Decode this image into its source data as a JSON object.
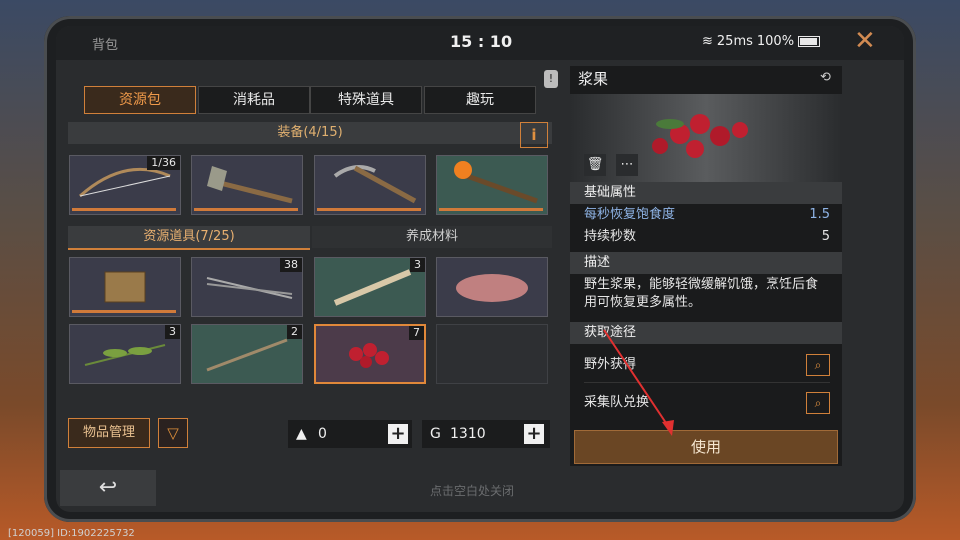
{
  "status_bar": {
    "title": "背包",
    "time": "15 : 10",
    "network": "25ms",
    "battery": "100%"
  },
  "tabs": [
    "资源包",
    "消耗品",
    "特殊道具",
    "趣玩"
  ],
  "equipment": {
    "header": "装备(4/15)",
    "info": "i",
    "items": [
      {
        "name": "bow-item",
        "count": "1/36"
      },
      {
        "name": "axe-item",
        "count": ""
      },
      {
        "name": "pickaxe-item",
        "count": ""
      },
      {
        "name": "torch-item",
        "count": ""
      }
    ]
  },
  "resources": {
    "tab_active": "资源道具(7/25)",
    "tab_other": "养成材料",
    "items": [
      {
        "name": "chest-item",
        "count": ""
      },
      {
        "name": "arrows-item",
        "count": "38"
      },
      {
        "name": "bone-item",
        "count": "3"
      },
      {
        "name": "meat-item",
        "count": ""
      },
      {
        "name": "leaves-item",
        "count": "3"
      },
      {
        "name": "branch-item",
        "count": "2"
      },
      {
        "name": "berries-item",
        "count": "7"
      },
      {
        "name": "empty-slot",
        "count": ""
      }
    ]
  },
  "bottom": {
    "manage": "物品管理",
    "filter": "▽",
    "currency1": "0",
    "currency2": "1310",
    "hint": "点击空白处关闭",
    "back": "↩"
  },
  "panel": {
    "title": "浆果",
    "attr_header": "基础属性",
    "attr1_label": "每秒恢复饱食度",
    "attr1_value": "1.5",
    "attr2_label": "持续秒数",
    "attr2_value": "5",
    "desc_header": "描述",
    "desc": "野生浆果，能够轻微缓解饥饿，烹饪后食用可恢复更多属性。",
    "source_header": "获取途径",
    "source1": "野外获得",
    "source2": "采集队兑换",
    "use": "使用"
  },
  "footer": "[120059] ID:1902225732",
  "colors": {
    "accent": "#d0803a",
    "attr_blue": "#8fb4e6"
  }
}
